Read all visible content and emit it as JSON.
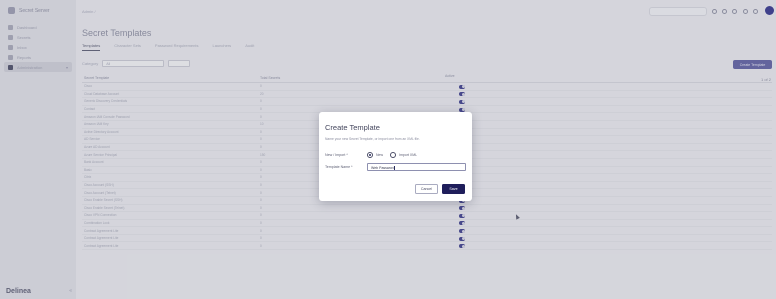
{
  "sidebar": {
    "brand": "Secret Server",
    "items": [
      {
        "label": "Dashboard"
      },
      {
        "label": "Secrets"
      },
      {
        "label": "Inbox"
      },
      {
        "label": "Reports"
      },
      {
        "label": "Administration",
        "active": true
      }
    ],
    "footer_logo": "Delinea",
    "collapse_icon": "chevrons-left-icon"
  },
  "topbar": {
    "breadcrumb": "Admin /",
    "icons": [
      "search-icon",
      "history-icon",
      "help-icon",
      "notifications-icon",
      "settings-icon",
      "user-avatar"
    ]
  },
  "page": {
    "title": "Secret Templates",
    "tabs": [
      {
        "label": "Templates",
        "active": true
      },
      {
        "label": "Character Sets"
      },
      {
        "label": "Password Requirements"
      },
      {
        "label": "Launchers"
      },
      {
        "label": "Audit"
      }
    ],
    "filter": {
      "category_label": "Category",
      "category_value": "All"
    },
    "create_button": "Create Template",
    "page_indicator": "1 of 2"
  },
  "table": {
    "columns": [
      "Secret Template",
      "Total Secrets",
      "Active"
    ],
    "rows": [
      {
        "name": "Cisco",
        "count": "0",
        "active": true
      },
      {
        "name": "Cloud Database Account",
        "count": "20",
        "active": true
      },
      {
        "name": "Generic Discovery Credentials",
        "count": "0",
        "active": true
      },
      {
        "name": "Contact",
        "count": "0",
        "active": true
      },
      {
        "name": "Amazon IAM Console Password",
        "count": "0",
        "active": true
      },
      {
        "name": "Amazon IAM Key",
        "count": "10",
        "active": true
      },
      {
        "name": "Active Directory Account",
        "count": "0",
        "active": true
      },
      {
        "name": "AD Service",
        "count": "0",
        "active": true
      },
      {
        "name": "Azure AD Account",
        "count": "0",
        "active": true
      },
      {
        "name": "Azure Service Principal",
        "count": "150",
        "active": true
      },
      {
        "name": "Bank Account",
        "count": "0",
        "active": true
      },
      {
        "name": "Basic",
        "count": "0",
        "active": true
      },
      {
        "name": "Citrix",
        "count": "0",
        "active": true
      },
      {
        "name": "Cisco Account (SSH)",
        "count": "0",
        "active": true
      },
      {
        "name": "Cisco Account (Telnet)",
        "count": "0",
        "active": true
      },
      {
        "name": "Cisco Enable Secret (SSH)",
        "count": "0",
        "active": true
      },
      {
        "name": "Cisco Enable Secret (Telnet)",
        "count": "0",
        "active": true
      },
      {
        "name": "Cisco VPN Connection",
        "count": "0",
        "active": true
      },
      {
        "name": "Combination Lock",
        "count": "0",
        "active": true
      },
      {
        "name": "Contract Agreement Lite",
        "count": "0",
        "active": true
      },
      {
        "name": "Contract Agreement Lite",
        "count": "0",
        "active": true
      },
      {
        "name": "Contract Agreement Lite",
        "count": "0",
        "active": true
      }
    ]
  },
  "modal": {
    "title": "Create Template",
    "description": "Name your new Secret Template, or import one from an XML file.",
    "new_import_label": "New / Import *",
    "option_new": "New",
    "option_import": "Import XML",
    "name_label": "Template Name *",
    "name_value": "Web Password",
    "cancel_label": "Cancel",
    "save_label": "Save"
  },
  "colors": {
    "primary": "#1f1e5b",
    "toggle_on": "#3c3e8c",
    "avatar": "#32348c"
  }
}
